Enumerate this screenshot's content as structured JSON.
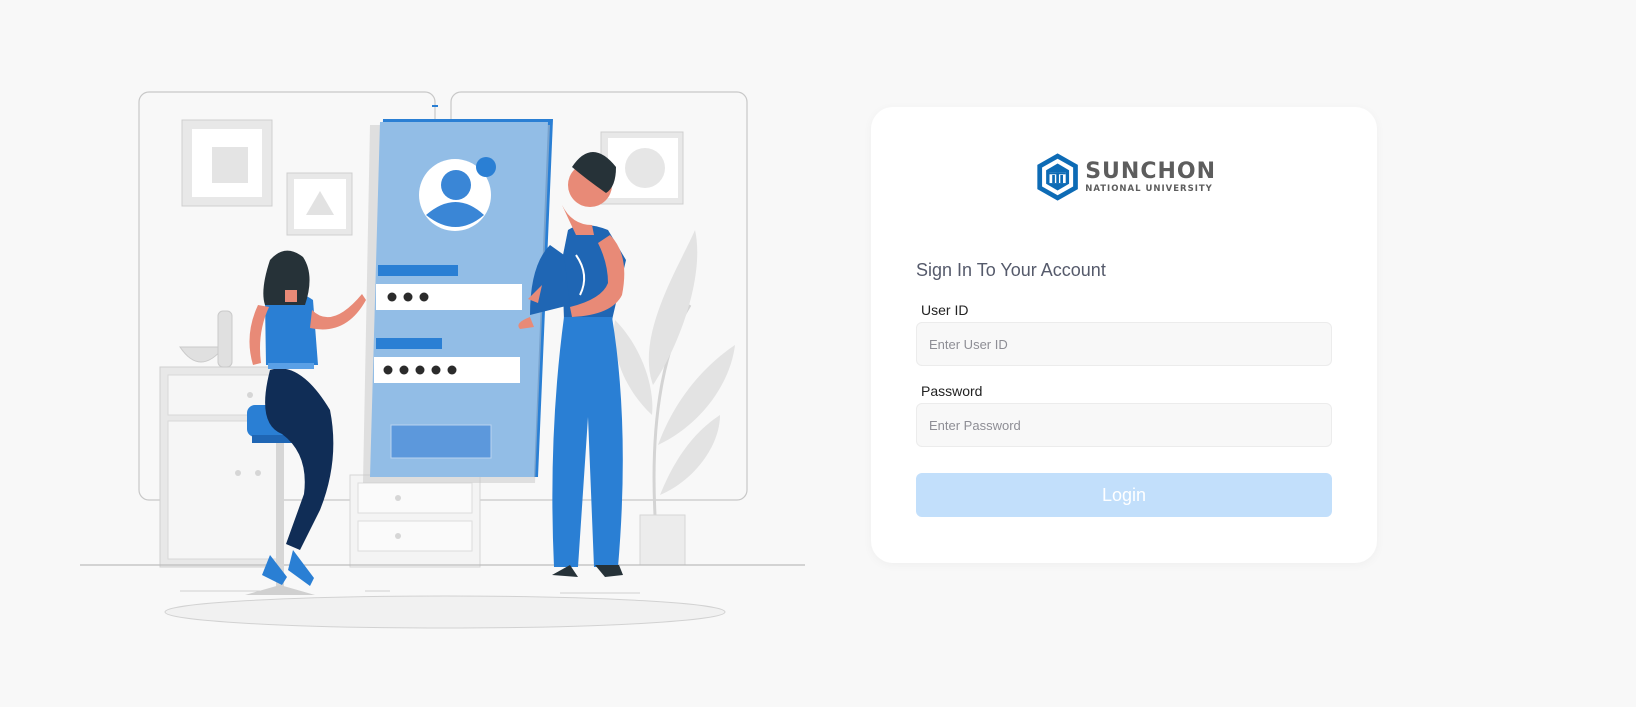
{
  "logo": {
    "name": "SUNCHON",
    "subtitle": "NATIONAL UNIVERSITY",
    "color": "#0d6bb5"
  },
  "form": {
    "title": "Sign In To Your Account",
    "user_id": {
      "label": "User ID",
      "placeholder": "Enter User ID",
      "value": ""
    },
    "password": {
      "label": "Password",
      "placeholder": "Enter Password",
      "value": ""
    },
    "login_label": "Login"
  },
  "colors": {
    "accent_blue": "#2a7fd4",
    "light_blue": "#92bde6",
    "login_disabled": "#c2dffb",
    "background": "#f8f8f8"
  }
}
